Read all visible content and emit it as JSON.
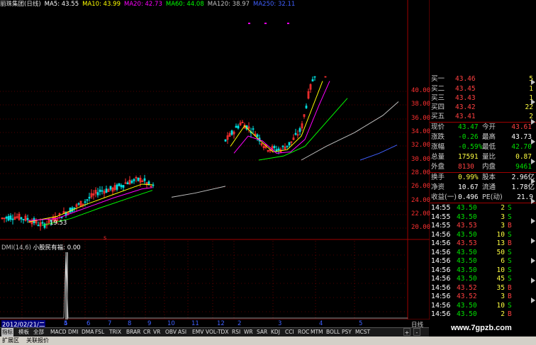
{
  "header": {
    "stock_name": "丽珠集团(日线)",
    "ma5": "MA5: 43.55",
    "ma10": "MA10: 43.99",
    "ma20": "MA20: 42.73",
    "ma60": "MA60: 44.08",
    "ma120": "MA120: 38.97",
    "ma250": "MA250: 32.11"
  },
  "colors": {
    "ma5": "#ffffff",
    "ma10": "#ffff00",
    "ma20": "#ff00ff",
    "ma60": "#00ff00",
    "ma120": "#c0c0c0",
    "ma250": "#4060ff",
    "up": "#ff3030",
    "down": "#00e0e0",
    "grid": "#a00000"
  },
  "price_axis": [
    "40.00",
    "38.00",
    "36.00",
    "34.00",
    "32.00",
    "30.00",
    "28.00",
    "26.00",
    "24.00",
    "22.00",
    "20.00"
  ],
  "low_annotation": "19.53",
  "indicator": {
    "label": "DMI(14,6)",
    "name": "小股民有福",
    "value": "0.00"
  },
  "date_axis": {
    "start": "2012/02/21/二",
    "months": [
      "4",
      "5",
      "6",
      "7",
      "8",
      "9",
      "10",
      "11",
      "12",
      "2",
      "3",
      "4",
      "5"
    ],
    "period": "日线"
  },
  "quote": {
    "bids": [
      {
        "label": "买一",
        "price": "43.46",
        "vol": "5"
      },
      {
        "label": "买二",
        "price": "43.45",
        "vol": "1"
      },
      {
        "label": "买三",
        "price": "43.43",
        "vol": "1"
      },
      {
        "label": "买四",
        "price": "43.42",
        "vol": "22"
      },
      {
        "label": "买五",
        "price": "43.41",
        "vol": "2"
      }
    ],
    "stats": [
      {
        "l1": "现价",
        "v1": "43.47",
        "l2": "今开",
        "v2": "43.61"
      },
      {
        "l1": "涨跌",
        "v1": "-0.26",
        "l2": "最高",
        "v2": "43.73"
      },
      {
        "l1": "涨幅",
        "v1": "-0.59%",
        "l2": "最低",
        "v2": "42.70"
      },
      {
        "l1": "总量",
        "v1": "17591",
        "l2": "量比",
        "v2": "0.87"
      },
      {
        "l1": "外盘",
        "v1": "8130",
        "l2": "内盘",
        "v2": "9461"
      }
    ],
    "stats2": [
      {
        "l1": "换手",
        "v1": "0.99%",
        "l2": "股本",
        "v2": "2.96亿"
      },
      {
        "l1": "净资",
        "v1": "10.67",
        "l2": "流通",
        "v2": "1.78亿"
      },
      {
        "l1": "收益(一)",
        "v1": "0.496",
        "l2": "PE(动)",
        "v2": "21.9"
      }
    ],
    "ticks": [
      {
        "time": "14:55",
        "price": "43.50",
        "vol": "2",
        "side": "S"
      },
      {
        "time": "14:55",
        "price": "43.50",
        "vol": "3",
        "side": "S"
      },
      {
        "time": "14:55",
        "price": "43.53",
        "vol": "3",
        "side": "B"
      },
      {
        "time": "14:56",
        "price": "43.50",
        "vol": "10",
        "side": "S"
      },
      {
        "time": "14:56",
        "price": "43.53",
        "vol": "13",
        "side": "B"
      },
      {
        "time": "14:56",
        "price": "43.50",
        "vol": "50",
        "side": "S"
      },
      {
        "time": "14:56",
        "price": "43.50",
        "vol": "6",
        "side": "S"
      },
      {
        "time": "14:56",
        "price": "43.50",
        "vol": "10",
        "side": "S"
      },
      {
        "time": "14:56",
        "price": "43.50",
        "vol": "45",
        "side": "S"
      },
      {
        "time": "14:56",
        "price": "43.52",
        "vol": "35",
        "side": "B"
      },
      {
        "time": "14:56",
        "price": "43.52",
        "vol": "3",
        "side": "B"
      },
      {
        "time": "14:56",
        "price": "43.50",
        "vol": "10",
        "side": "S"
      },
      {
        "time": "14:56",
        "price": "43.50",
        "vol": "2",
        "side": "B"
      }
    ]
  },
  "tabs": [
    "指标",
    "模板",
    "全部",
    "MACD",
    "DMI",
    "DMA",
    "FSL",
    "TRIX",
    "BRAR",
    "CR",
    "VR",
    "OBV",
    "ASI",
    "EMV",
    "VOL-TDX",
    "RSI",
    "WR",
    "SAR",
    "KDJ",
    "CCI",
    "ROC",
    "MTM",
    "BOLL",
    "PSY",
    "MCST"
  ],
  "active_tab": "指标",
  "tab_controls": [
    "+",
    "-"
  ],
  "status": [
    "扩展区",
    "关联报价"
  ],
  "watermark": "www.7gpzb.com"
}
